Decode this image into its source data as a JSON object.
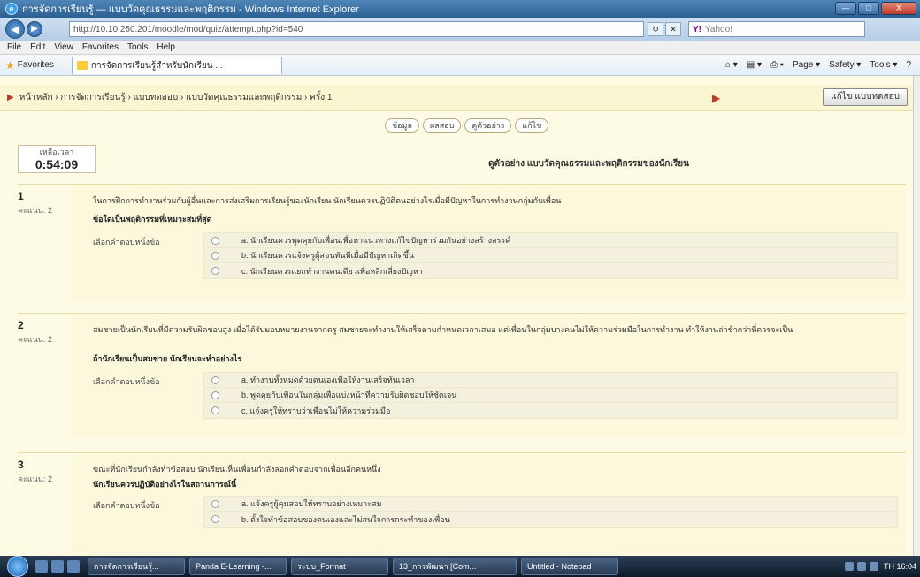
{
  "window": {
    "title": "การจัดการเรียนรู้ — แบบวัดคุณธรรมและพฤติกรรม - Windows Internet Explorer",
    "minimize": "—",
    "maximize": "□",
    "close": "X"
  },
  "addressbar": {
    "url": "http://10.10.250.201/moodle/mod/quiz/attempt.php?id=540",
    "search_provider": "Y!",
    "search_placeholder": "Yahoo!"
  },
  "menu": [
    "File",
    "Edit",
    "View",
    "Favorites",
    "Tools",
    "Help"
  ],
  "favorites": {
    "label": "Favorites",
    "tab_title": "การจัดการเรียนรู้สำหรับนักเรียน ..."
  },
  "commandbar": [
    "Page ▾",
    "Safety ▾",
    "Tools ▾",
    "?"
  ],
  "navbar": {
    "breadcrumb": "หน้าหลัก › การจัดการเรียนรู้ › แบบทดสอบ › แบบวัดคุณธรรมและพฤติกรรม › ครั้ง 1",
    "end_button": "แก้ไข แบบทดสอบ"
  },
  "quiz_tabs": [
    "ข้อมูล",
    "ผลสอบ",
    "ดูตัวอย่าง",
    "แก้ไข"
  ],
  "timer": {
    "label": "เหลือเวลา",
    "value": "0:54:09"
  },
  "quiz_heading": "ดูตัวอย่าง แบบวัดคุณธรรมและพฤติกรรมของนักเรียน",
  "questions": [
    {
      "number": "1",
      "marks": "คะแนน: 2",
      "text": "ในการฝึกการทำงานร่วมกับผู้อื่นและการส่งเสริมการเรียนรู้ของนักเรียน นักเรียนควรปฏิบัติตนอย่างไรเมื่อมีปัญหาในการทำงานกลุ่มกับเพื่อน",
      "bold": "ข้อใดเป็นพฤติกรรมที่เหมาะสมที่สุด",
      "choose_label": "เลือกคำตอบหนึ่งข้อ",
      "options": [
        "a. นักเรียนควรพูดคุยกับเพื่อนเพื่อหาแนวทางแก้ไขปัญหาร่วมกันอย่างสร้างสรรค์",
        "b. นักเรียนควรแจ้งครูผู้สอนทันทีเมื่อมีปัญหาเกิดขึ้น",
        "c. นักเรียนควรแยกทำงานคนเดียวเพื่อหลีกเลี่ยงปัญหา"
      ]
    },
    {
      "number": "2",
      "marks": "คะแนน: 2",
      "text": "สมชายเป็นนักเรียนที่มีความรับผิดชอบสูง เมื่อได้รับมอบหมายงานจากครู สมชายจะทำงานให้เสร็จตามกำหนดเวลาเสมอ แต่เพื่อนในกลุ่มบางคนไม่ให้ความร่วมมือในการทำงาน ทำให้งานล่าช้ากว่าที่ควรจะเป็น",
      "bold": "ถ้านักเรียนเป็นสมชาย นักเรียนจะทำอย่างไร",
      "choose_label": "เลือกคำตอบหนึ่งข้อ",
      "options": [
        "a. ทำงานทั้งหมดด้วยตนเองเพื่อให้งานเสร็จทันเวลา",
        "b. พูดคุยกับเพื่อนในกลุ่มเพื่อแบ่งหน้าที่ความรับผิดชอบให้ชัดเจน",
        "c. แจ้งครูให้ทราบว่าเพื่อนไม่ให้ความร่วมมือ"
      ]
    },
    {
      "number": "3",
      "marks": "คะแนน: 2",
      "text": "ขณะที่นักเรียนกำลังทำข้อสอบ นักเรียนเห็นเพื่อนกำลังลอกคำตอบจากเพื่อนอีกคนหนึ่ง",
      "bold": "นักเรียนควรปฏิบัติอย่างไรในสถานการณ์นี้",
      "choose_label": "เลือกคำตอบหนึ่งข้อ",
      "options": [
        "a. แจ้งครูผู้คุมสอบให้ทราบอย่างเหมาะสม",
        "b. ตั้งใจทำข้อสอบของตนเองและไม่สนใจการกระทำของเพื่อน"
      ]
    }
  ],
  "taskbar": {
    "tasks": [
      "การจัดการเรียนรู้...",
      "Panda E-Learning -...",
      "ระบบ_Format",
      "13_การพัฒนา [Com...",
      "Untitled - Notepad"
    ],
    "clock": "TH  16:04"
  }
}
